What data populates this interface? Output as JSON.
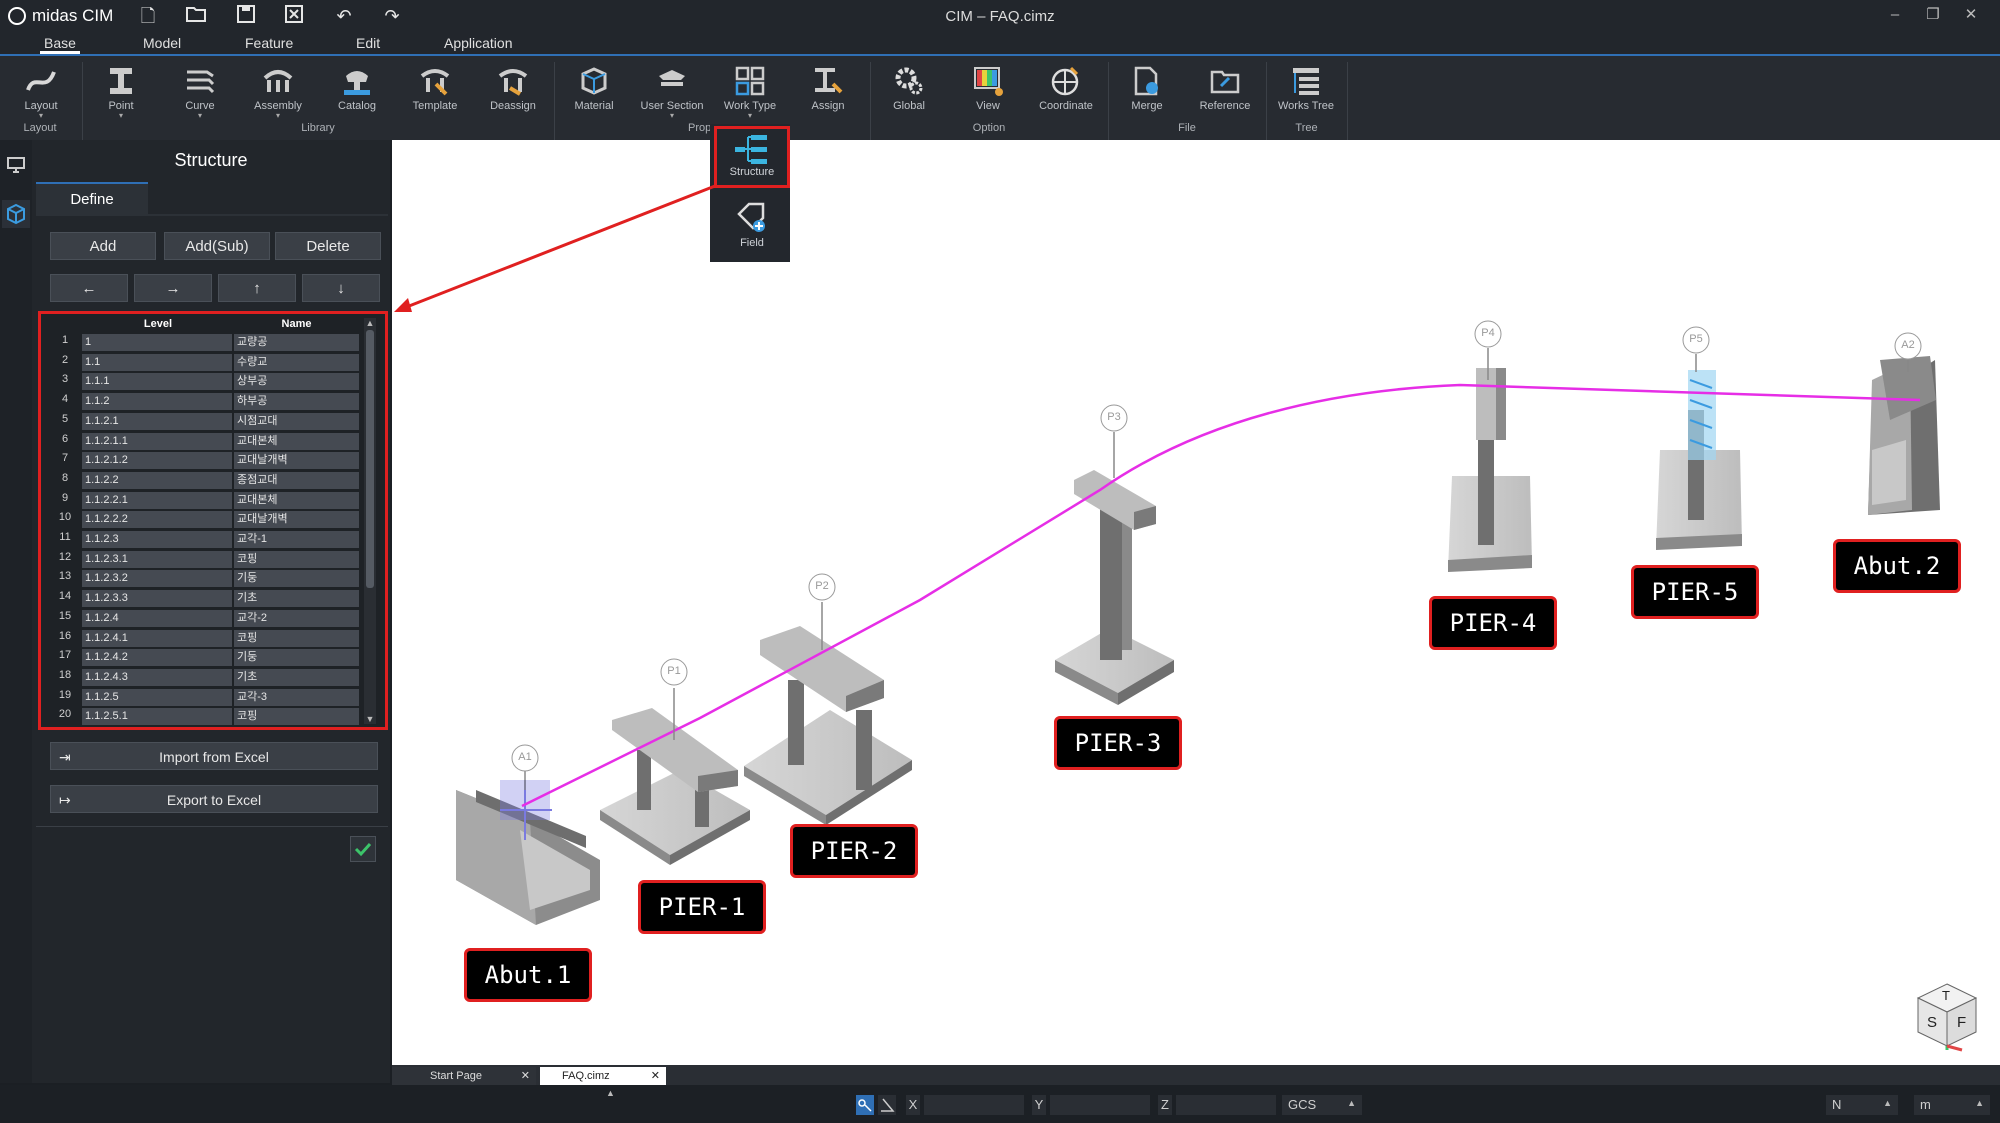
{
  "app": {
    "logo": "midas CIM",
    "window_title": "CIM – FAQ.cimz"
  },
  "menu": [
    "Base",
    "Model",
    "Feature",
    "Edit",
    "Application"
  ],
  "ribbon": {
    "buttons": {
      "layout": "Layout",
      "point": "Point",
      "curve": "Curve",
      "assembly": "Assembly",
      "catalog": "Catalog",
      "template": "Template",
      "deassign": "Deassign",
      "material": "Material",
      "user_section": "User Section",
      "work_type": "Work Type",
      "assign": "Assign",
      "global": "Global",
      "view": "View",
      "coordinate": "Coordinate",
      "merge": "Merge",
      "reference": "Reference",
      "works_tree": "Works Tree"
    },
    "groups": {
      "layout": "Layout",
      "library": "Library",
      "prop": "Prop",
      "option": "Option",
      "file": "File",
      "tree": "Tree"
    }
  },
  "work_type_dropdown": {
    "structure": "Structure",
    "field": "Field"
  },
  "panel": {
    "title": "Structure",
    "tab": "Define",
    "buttons": {
      "add": "Add",
      "add_sub": "Add(Sub)",
      "delete": "Delete"
    },
    "arrows": {
      "left": "←",
      "right": "→",
      "up": "↑",
      "down": "↓"
    },
    "table": {
      "headers": {
        "level": "Level",
        "name": "Name"
      },
      "rows": [
        {
          "n": "1",
          "level": "1",
          "name": "교량공"
        },
        {
          "n": "2",
          "level": "1.1",
          "name": "수량교"
        },
        {
          "n": "3",
          "level": "1.1.1",
          "name": "상부공"
        },
        {
          "n": "4",
          "level": "1.1.2",
          "name": "하부공"
        },
        {
          "n": "5",
          "level": "1.1.2.1",
          "name": "시점교대"
        },
        {
          "n": "6",
          "level": "1.1.2.1.1",
          "name": "교대본체"
        },
        {
          "n": "7",
          "level": "1.1.2.1.2",
          "name": "교대날개벽"
        },
        {
          "n": "8",
          "level": "1.1.2.2",
          "name": "종점교대"
        },
        {
          "n": "9",
          "level": "1.1.2.2.1",
          "name": "교대본체"
        },
        {
          "n": "10",
          "level": "1.1.2.2.2",
          "name": "교대날개벽"
        },
        {
          "n": "11",
          "level": "1.1.2.3",
          "name": "교각-1"
        },
        {
          "n": "12",
          "level": "1.1.2.3.1",
          "name": "코핑"
        },
        {
          "n": "13",
          "level": "1.1.2.3.2",
          "name": "기둥"
        },
        {
          "n": "14",
          "level": "1.1.2.3.3",
          "name": "기초"
        },
        {
          "n": "15",
          "level": "1.1.2.4",
          "name": "교각-2"
        },
        {
          "n": "16",
          "level": "1.1.2.4.1",
          "name": "코핑"
        },
        {
          "n": "17",
          "level": "1.1.2.4.2",
          "name": "기둥"
        },
        {
          "n": "18",
          "level": "1.1.2.4.3",
          "name": "기초"
        },
        {
          "n": "19",
          "level": "1.1.2.5",
          "name": "교각-3"
        },
        {
          "n": "20",
          "level": "1.1.2.5.1",
          "name": "코핑"
        }
      ]
    },
    "import": "Import from Excel",
    "export": "Export to Excel"
  },
  "viewport": {
    "markers": [
      "A1",
      "P1",
      "P2",
      "P3",
      "P4",
      "P5",
      "A2"
    ],
    "labels": [
      "Abut.1",
      "PIER-1",
      "PIER-2",
      "PIER-3",
      "PIER-4",
      "PIER-5",
      "Abut.2"
    ],
    "navcube": {
      "top": "T",
      "left": "S",
      "right": "F"
    },
    "alignment_color": "#e62ee6",
    "label_border_color": "#e02020"
  },
  "doc_tabs": [
    "Start Page",
    "FAQ.cimz"
  ],
  "status": {
    "x": "X",
    "y": "Y",
    "z": "Z",
    "coord_system": "GCS",
    "unit_force": "N",
    "unit_length": "m"
  }
}
